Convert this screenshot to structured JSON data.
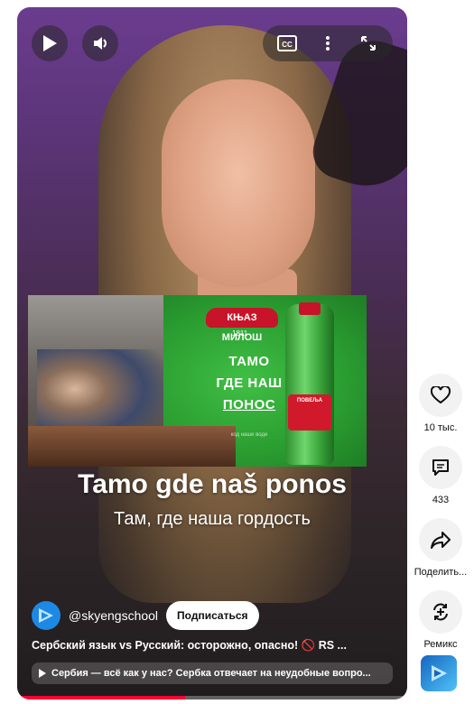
{
  "overlay": {
    "subtitle_serbian": "Tamo gde naš ponos",
    "subtitle_russian": "Там, где наша гордость"
  },
  "ad": {
    "brand": "КЊАЗ МИЛОШ",
    "year": "1811",
    "text_line1": "ТАМО",
    "text_line2": "ГДЕ НАШ",
    "text_line3": "ПОНОС",
    "small_text": "код наше воде",
    "bottle_label": "ПОВЕЉА"
  },
  "channel": {
    "handle": "@skyengschool",
    "subscribe_label": "Подписаться"
  },
  "video": {
    "title": "Сербский язык vs Русский: осторожно, опасно! 🚫 RS ...",
    "playlist": "Сербия — всё как у нас? Сербка отвечает на неудобные вопро..."
  },
  "progress": {
    "fraction": 0.43
  },
  "actions": {
    "like_count": "10 тыс.",
    "comments_count": "433",
    "share_label": "Поделить...",
    "remix_label": "Ремикс"
  },
  "colors": {
    "accent": "#ff0033",
    "action_bg": "#f2f2f2"
  }
}
